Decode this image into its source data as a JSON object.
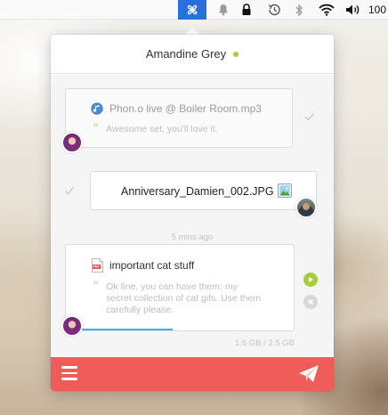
{
  "menubar": {
    "app_icon": "propeller-icon",
    "status_icons": [
      "bell-icon",
      "lock-icon",
      "time-machine-icon",
      "bluetooth-icon",
      "wifi-icon",
      "volume-icon"
    ],
    "battery_text": "100"
  },
  "conversation": {
    "contact_name": "Amandine Grey",
    "status_color": "#a6cf3f"
  },
  "messages": [
    {
      "file_name": "Phon.o live @ Boiler Room.mp3",
      "file_icon": "audio-file-icon",
      "note": "Awesome set, you'll love it.",
      "status": "delivered"
    },
    {
      "file_name": "Anniversary_Damien_002.JPG",
      "file_icon": "image-file-icon",
      "status": "delivered"
    },
    {
      "file_name": "important cat stuff",
      "file_icon": "pdf-file-icon",
      "note_lines": [
        "Ok fine, you can have them: my",
        "secret collection of cat gifs. Use them",
        "carefully please."
      ],
      "transfer_progress": 0.45,
      "size_text": "1.6 GB / 2.5 GB"
    }
  ],
  "timestamp": "5 mins ago",
  "footer": {
    "menu_icon": "hamburger-icon",
    "send_icon": "paper-plane-icon",
    "color": "#ef5c5a"
  }
}
